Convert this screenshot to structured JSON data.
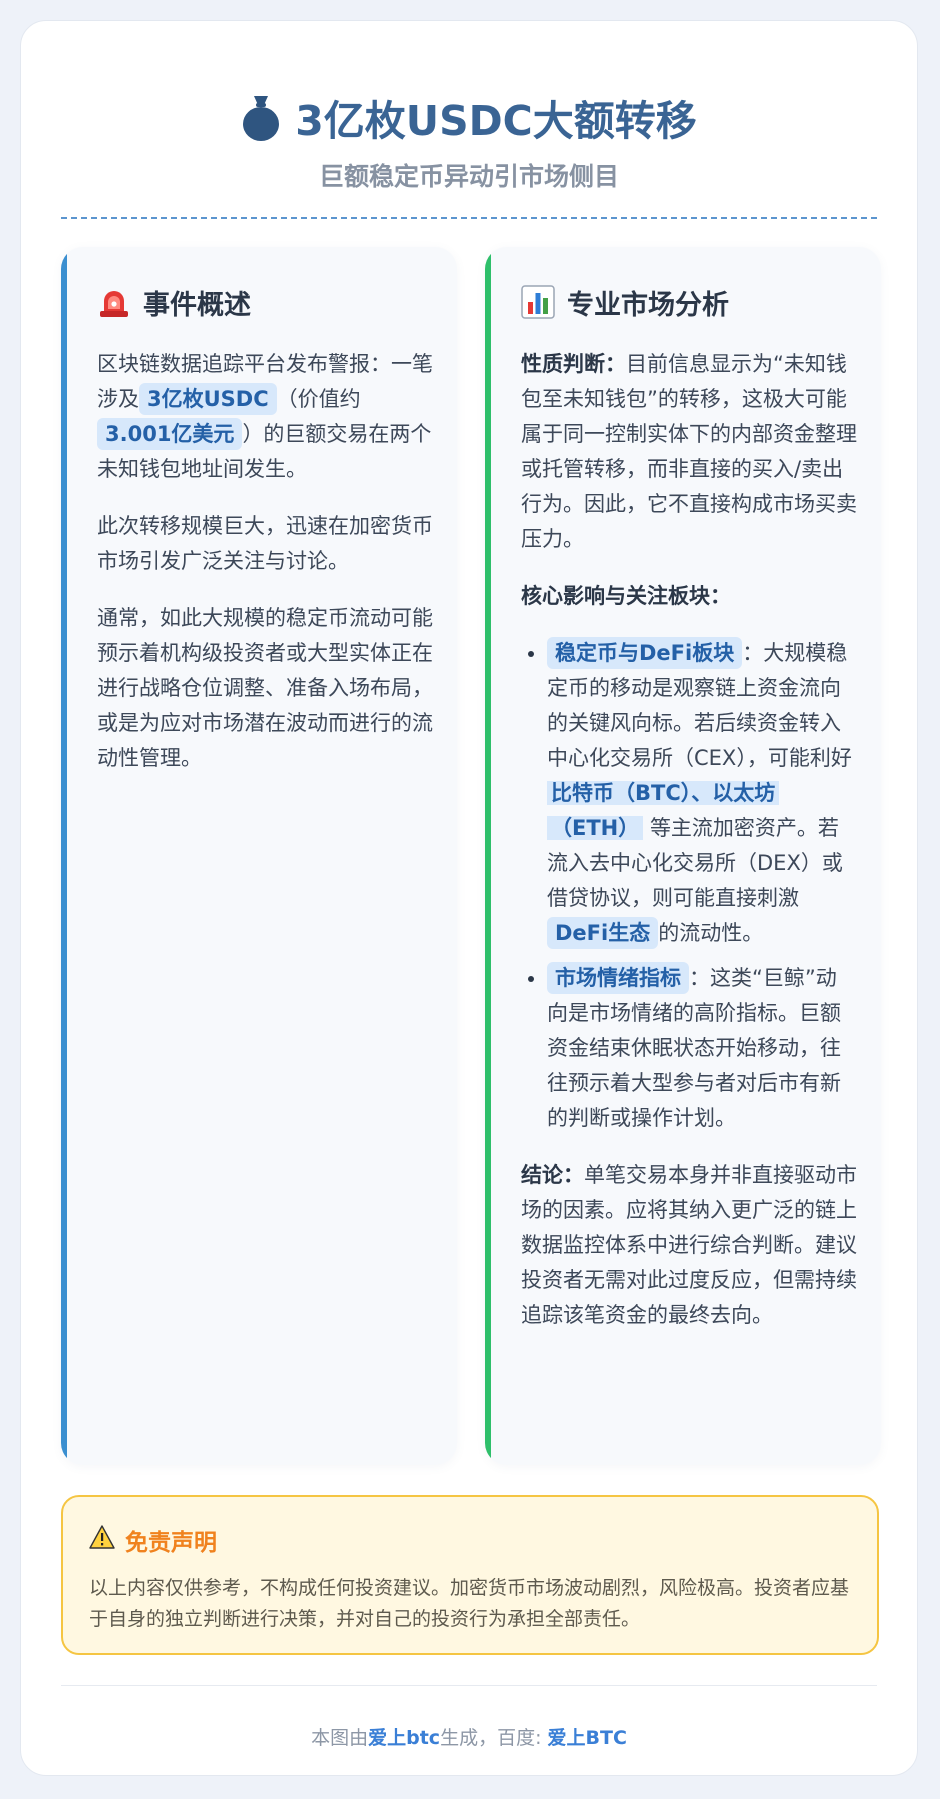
{
  "header": {
    "title": "3亿枚USDC大额转移",
    "subtitle": "巨额稳定币异动引市场侧目",
    "icon": "money-bag-icon"
  },
  "overview": {
    "heading": "事件概述",
    "icon": "siren-icon",
    "p1": {
      "part1": "区块链数据追踪平台发布警报：一笔涉及",
      "hl1": "3亿枚USDC",
      "part2": "（价值约",
      "hl2": "3.001亿美元",
      "part3": "）的巨额交易在两个未知钱包地址间发生。"
    },
    "p2": "此次转移规模巨大，迅速在加密货币市场引发广泛关注与讨论。",
    "p3": "通常，如此大规模的稳定币流动可能预示着机构级投资者或大型实体正在进行战略仓位调整、准备入场布局，或是为应对市场潜在波动而进行的流动性管理。"
  },
  "analysis": {
    "heading": "专业市场分析",
    "icon": "bar-chart-icon",
    "nature": {
      "label": "性质判断：",
      "text": "目前信息显示为“未知钱包至未知钱包”的转移，这极大可能属于同一控制实体下的内部资金整理或托管转移，而非直接的买入/卖出行为。因此，它不直接构成市场买卖压力。"
    },
    "core_heading": "核心影响与关注板块：",
    "bullet1": {
      "hl1": "稳定币与DeFi板块",
      "part1": "：大规模稳定币的移动是观察链上资金流向的关键风向标。若后续资金转入中心化交易所（CEX），可能利好",
      "hl2": "比特币（BTC）、以太坊（ETH）",
      "part2": "等主流加密资产。若流入去中心化交易所（DEX）或借贷协议，则可能直接刺激",
      "hl3": "DeFi生态",
      "part3": "的流动性。"
    },
    "bullet2": {
      "hl1": "市场情绪指标",
      "part1": "：这类“巨鲸”动向是市场情绪的高阶指标。巨额资金结束休眠状态开始移动，往往预示着大型参与者对后市有新的判断或操作计划。"
    },
    "conclusion": {
      "label": "结论：",
      "text": "单笔交易本身并非直接驱动市场的因素。应将其纳入更广泛的链上数据监控体系中进行综合判断。建议投资者无需对此过度反应，但需持续追踪该笔资金的最终去向。"
    }
  },
  "disclaimer": {
    "heading": "免责声明",
    "icon": "warning-icon",
    "text": "以上内容仅供参考，不构成任何投资建议。加密货币市场波动剧烈，风险极高。投资者应基于自身的独立判断进行决策，并对自己的投资行为承担全部责任。"
  },
  "footer": {
    "prefix": "本图由",
    "brand1": "爱上btc",
    "middle": "生成，百度: ",
    "brand2": "爱上BTC"
  },
  "colors": {
    "title": "#3a6494",
    "left_accent": "#3b8fd0",
    "right_accent": "#2ebf6a",
    "highlight_bg": "#d7e8fb",
    "highlight_text": "#2460a7",
    "warning": "#f0821e"
  }
}
